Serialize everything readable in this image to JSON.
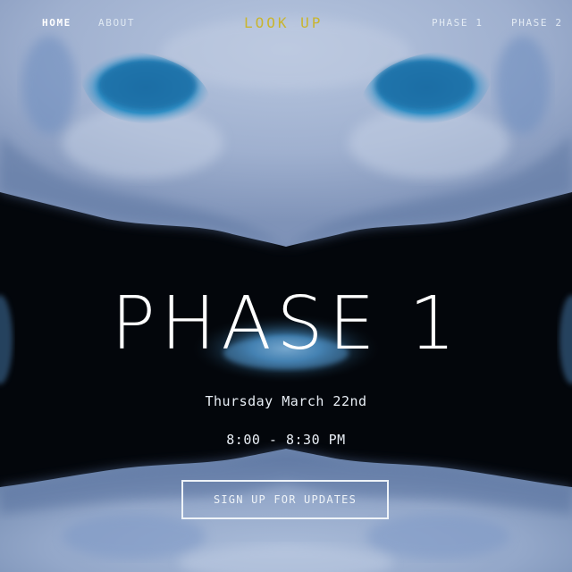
{
  "nav": {
    "home": "HOME",
    "about": "ABOUT",
    "brand": "LOOK UP",
    "phase1": "PHASE 1",
    "phase2": "PHASE 2"
  },
  "hero": {
    "title": "PHASE 1",
    "date": "Thursday March 22nd",
    "time": "8:00 - 8:30 PM",
    "cta_label": "SIGN UP FOR UPDATES"
  },
  "colors": {
    "brand": "#c9b52e",
    "text": "#ffffff",
    "accent_blue": "#2f8fc6"
  }
}
